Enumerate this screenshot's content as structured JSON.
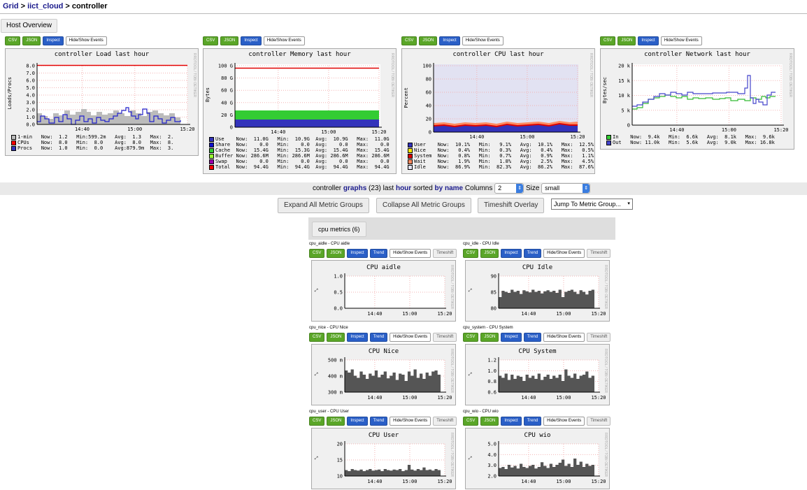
{
  "breadcrumb": {
    "grid": "Grid",
    "cluster": "iict_cloud",
    "host": "controller",
    "sep": ">"
  },
  "host_overview_label": "Host Overview",
  "buttons": {
    "csv": "CSV",
    "json": "JSON",
    "inspect": "Inspect",
    "hideshow": "Hide/Show Events",
    "trend": "Trend",
    "timeshift": "Timeshift"
  },
  "watermark": "RRDTOOL / TOBI OETIKER",
  "top_graphs": {
    "load": {
      "title": "controller Load last hour",
      "ylabel": "Loads/Procs",
      "yticks": [
        "8.0",
        "7.0",
        "6.0",
        "5.0",
        "4.0",
        "3.0",
        "2.0",
        "1.0",
        "0.0"
      ],
      "xticks": [
        "14:40",
        "15:00",
        "15:20"
      ],
      "legend": [
        {
          "color": "#bbbbbb",
          "text": "1-min   Now:  1.2   Min:599.2m   Avg:  1.3   Max:  2."
        },
        {
          "color": "#ff0000",
          "text": "CPUs    Now:  8.0   Min:  8.0    Avg:  8.0   Max:  8."
        },
        {
          "color": "#3333bb",
          "text": "Procs   Now:  1.0   Min:  0.0    Avg:879.9m  Max:  3."
        }
      ]
    },
    "memory": {
      "title": "controller Memory last hour",
      "ylabel": "Bytes",
      "yticks": [
        "100 G",
        "80 G",
        "60 G",
        "40 G",
        "20 G",
        "0"
      ],
      "xticks": [
        "14:40",
        "15:00",
        "15:20"
      ],
      "legend": [
        {
          "color": "#3333bb",
          "text": "Use    Now:  11.0G   Min:  10.9G  Avg:  10.9G   Max:  11.0G"
        },
        {
          "color": "#1111cc",
          "text": "Share  Now:    0.0   Min:    0.0  Avg:    0.0   Max:    0.0"
        },
        {
          "color": "#33cc33",
          "text": "Cache  Now:  15.4G   Min:  15.3G  Avg:  15.4G   Max:  15.4G"
        },
        {
          "color": "#99ff33",
          "text": "Buffer Now: 286.6M   Min: 286.6M  Avg: 286.6M   Max: 286.6M"
        },
        {
          "color": "#9900aa",
          "text": "Swap   Now:    0.0   Min:    0.0  Avg:    0.0   Max:    0.0"
        },
        {
          "color": "#ff0000",
          "text": "Total  Now:  94.4G   Min:  94.4G  Avg:  94.4G   Max:  94.4G"
        }
      ]
    },
    "cpu": {
      "title": "controller CPU last hour",
      "ylabel": "Percent",
      "yticks": [
        "100",
        "80",
        "60",
        "40",
        "20",
        "0"
      ],
      "xticks": [
        "14:40",
        "15:00",
        "15:20"
      ],
      "legend": [
        {
          "color": "#3333bb",
          "text": "User    Now:  10.1%   Min:   9.1%   Avg:  10.1%   Max:  12.5%"
        },
        {
          "color": "#ffea00",
          "text": "Nice    Now:   0.4%   Min:   0.3%   Avg:   0.4%   Max:   0.5%"
        },
        {
          "color": "#dd0000",
          "text": "System  Now:   0.8%   Min:   0.7%   Avg:   0.9%   Max:   1.1%"
        },
        {
          "color": "#ff8a60",
          "text": "Wait    Now:   1.9%   Min:   1.8%   Avg:   2.5%   Max:   4.5%"
        },
        {
          "color": "#e2e2f2",
          "text": "Idle    Now:  86.9%   Min:  82.3%   Avg:  86.2%   Max:  87.6%"
        }
      ]
    },
    "network": {
      "title": "controller Network last hour",
      "ylabel": "Bytes/sec",
      "yticks": [
        "20 k",
        "15 k",
        "10 k",
        "5 k",
        "0"
      ],
      "xticks": [
        "14:40",
        "15:00",
        "15:20"
      ],
      "legend": [
        {
          "color": "#33cc33",
          "text": "In    Now:  9.4k   Min:  6.6k   Avg:  8.1k   Max:  9.6k"
        },
        {
          "color": "#4444cc",
          "text": "Out   Now: 11.0k   Min:  5.6k   Avg:  9.0k   Max: 16.8k"
        }
      ]
    }
  },
  "toolbar": {
    "host": "controller",
    "graphs": "graphs",
    "count": "(23)",
    "last": "last",
    "range": "hour",
    "sorted": "sorted",
    "by_name": "by name",
    "columns_label": "Columns",
    "columns_value": "2",
    "size_label": "Size",
    "size_value": "small"
  },
  "actions": {
    "expand": "Expand All Metric Groups",
    "collapse": "Collapse All Metric Groups",
    "timeshift": "Timeshift Overlay",
    "jump": "Jump To Metric Group..."
  },
  "group_label": "cpu metrics (6)",
  "metrics": [
    {
      "id": "cpu_aidle - CPU aidle",
      "title": "CPU aidle",
      "yticks": [
        "1.0",
        "0.5",
        "0.0"
      ],
      "xticks": [
        "14:40",
        "15:00",
        "15:20"
      ]
    },
    {
      "id": "cpu_idle - CPU Idle",
      "title": "CPU Idle",
      "yticks": [
        "90",
        "85",
        "80"
      ],
      "xticks": [
        "14:40",
        "15:00",
        "15:20"
      ]
    },
    {
      "id": "cpu_nice - CPU Nice",
      "title": "CPU Nice",
      "yticks": [
        "500 m",
        "400 m",
        "300 m"
      ],
      "xticks": [
        "14:40",
        "15:00",
        "15:20"
      ]
    },
    {
      "id": "cpu_system - CPU System",
      "title": "CPU System",
      "yticks": [
        "1.2",
        "1.0",
        "0.8",
        "0.6"
      ],
      "xticks": [
        "14:40",
        "15:00",
        "15:20"
      ]
    },
    {
      "id": "cpu_user - CPU User",
      "title": "CPU User",
      "yticks": [
        "20",
        "15",
        "10"
      ],
      "xticks": [
        "14:40",
        "15:00",
        "15:20"
      ]
    },
    {
      "id": "cpu_wio - CPU wio",
      "title": "CPU wio",
      "yticks": [
        "5.0",
        "4.0",
        "3.0",
        "2.0"
      ],
      "xticks": [
        "14:40",
        "15:00",
        "15:20"
      ]
    }
  ]
}
